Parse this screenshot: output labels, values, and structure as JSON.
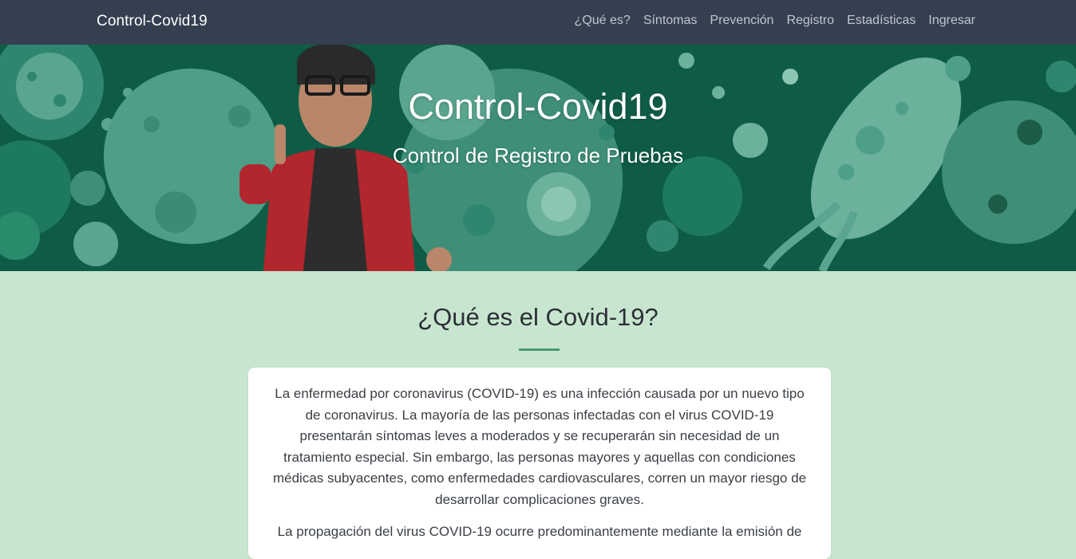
{
  "navbar": {
    "brand": "Control-Covid19",
    "links": [
      {
        "label": "¿Qué es?"
      },
      {
        "label": "Síntomas"
      },
      {
        "label": "Prevención"
      },
      {
        "label": "Registro"
      },
      {
        "label": "Estadísticas"
      },
      {
        "label": "Ingresar"
      }
    ]
  },
  "hero": {
    "title": "Control-Covid19",
    "subtitle": "Control de Registro de Pruebas"
  },
  "section": {
    "title": "¿Qué es el Covid-19?",
    "paragraphs": [
      "La enfermedad por coronavirus (COVID-19) es una infección causada por un nuevo tipo de coronavirus. La mayoría de las personas infectadas con el virus COVID-19 presentarán síntomas leves a moderados y se recuperarán sin necesidad de un tratamiento especial. Sin embargo, las personas mayores y aquellas con condiciones médicas subyacentes, como enfermedades cardiovasculares, corren un mayor riesgo de desarrollar complicaciones graves.",
      "La propagación del virus COVID-19 ocurre predominantemente mediante la emisión de"
    ]
  },
  "colors": {
    "navbar_bg": "#343f50",
    "page_bg": "#c8e6cf",
    "accent": "#4a9a71",
    "hero_bg": "#0f5c46"
  }
}
